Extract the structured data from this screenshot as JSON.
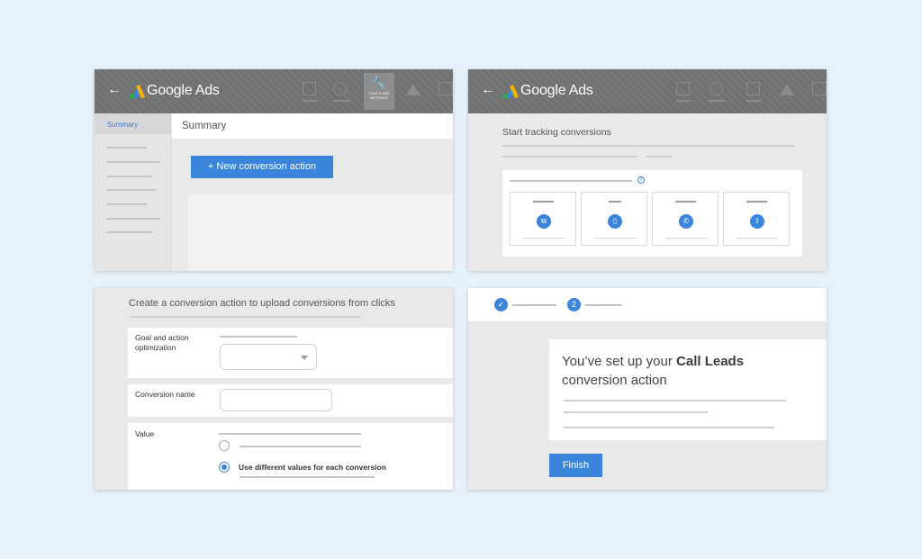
{
  "app": {
    "back": "←",
    "brand": "Google Ads",
    "tools_label": "TOOLS AND SETTINGS",
    "tools_icon": "wrench-icon"
  },
  "panel1": {
    "sidebar_selected": "Summary",
    "page_title": "Summary",
    "new_action_button": "+  New conversion action"
  },
  "panel2": {
    "title": "Start tracking conversions",
    "help_glyph": "?",
    "cards": [
      {
        "icon": "website-icon",
        "glyph": "⧉"
      },
      {
        "icon": "app-icon",
        "glyph": "▯"
      },
      {
        "icon": "phone-icon",
        "glyph": "✆"
      },
      {
        "icon": "upload-icon",
        "glyph": "⇧"
      }
    ]
  },
  "panel3": {
    "title": "Create a conversion action to upload conversions from clicks",
    "goal_label": "Goal and action optimization",
    "name_label": "Conversion name",
    "value_label": "Value",
    "radio_option": "Use different values for each conversion"
  },
  "panel4": {
    "step1_glyph": "✓",
    "step2_number": "2",
    "message_prefix": "You’ve set up your ",
    "message_bold": "Call Leads",
    "message_suffix": "conversion action",
    "finish_button": "Finish"
  },
  "colors": {
    "accent": "#3a84dc",
    "header": "#707173"
  }
}
